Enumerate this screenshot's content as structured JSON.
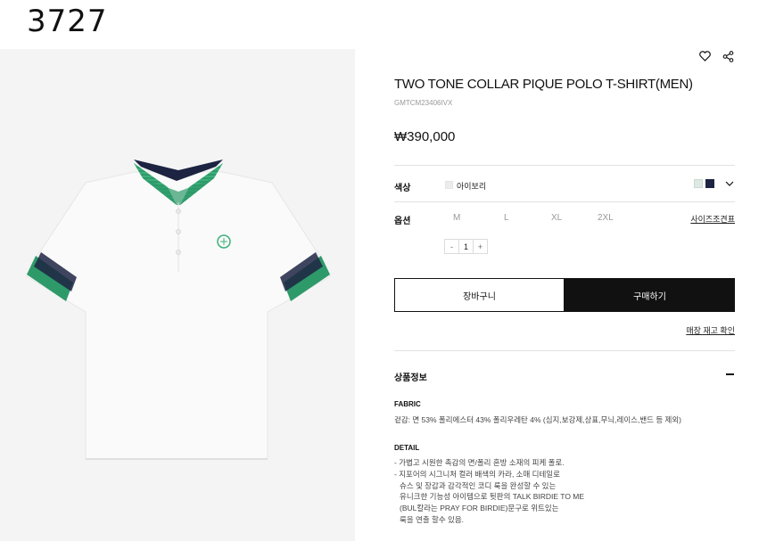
{
  "page_number": "3727",
  "product": {
    "title": "TWO TONE COLLAR PIQUE POLO T-SHIRT(MEN)",
    "sku": "GMTCM23406IVX",
    "price": "₩390,000"
  },
  "icons": {
    "wishlist": "heart-icon",
    "share": "share-icon"
  },
  "color": {
    "label": "색상",
    "selected_name": "아이보리",
    "swatches": [
      "#dfe9e4",
      "#1d2442"
    ]
  },
  "options": {
    "label": "옵션",
    "sizes": [
      "M",
      "L",
      "XL",
      "2XL"
    ],
    "size_guide": "사이즈조견표"
  },
  "quantity": {
    "minus": "-",
    "value": "1",
    "plus": "+"
  },
  "buttons": {
    "cart": "장바구니",
    "buy": "구매하기"
  },
  "store_stock": "매장 재고 확인",
  "details": {
    "section_title": "상품정보",
    "fabric_title": "FABRIC",
    "fabric_text": "겉감: 면 53% 폴리에스터 43% 폴리우레탄 4% (심지,보강제,상표,무늬,레이스,밴드 등 제외)",
    "detail_title": "DETAIL",
    "detail_lines": [
      "- 가볍고 시원한 촉감의 면/폴리 혼방 소재의 피케 폴로.",
      "- 지포어의 시그니처 컬러 배색의 카라, 소매 디테일로",
      "슈스 및 장갑과 감각적인 코디 룩을 완성할 수 있는",
      "유니크한 기능성 아이템으로 뒷판의 TALK BIRDIE TO ME",
      "(BUL칼라는 PRAY FOR BIRDIE)문구로 위트있는",
      "룩을 연출 할수 있음."
    ]
  },
  "colors": {
    "accent_green": "#2e9a6a",
    "navy": "#1d2442",
    "buy_button": "#111111"
  }
}
